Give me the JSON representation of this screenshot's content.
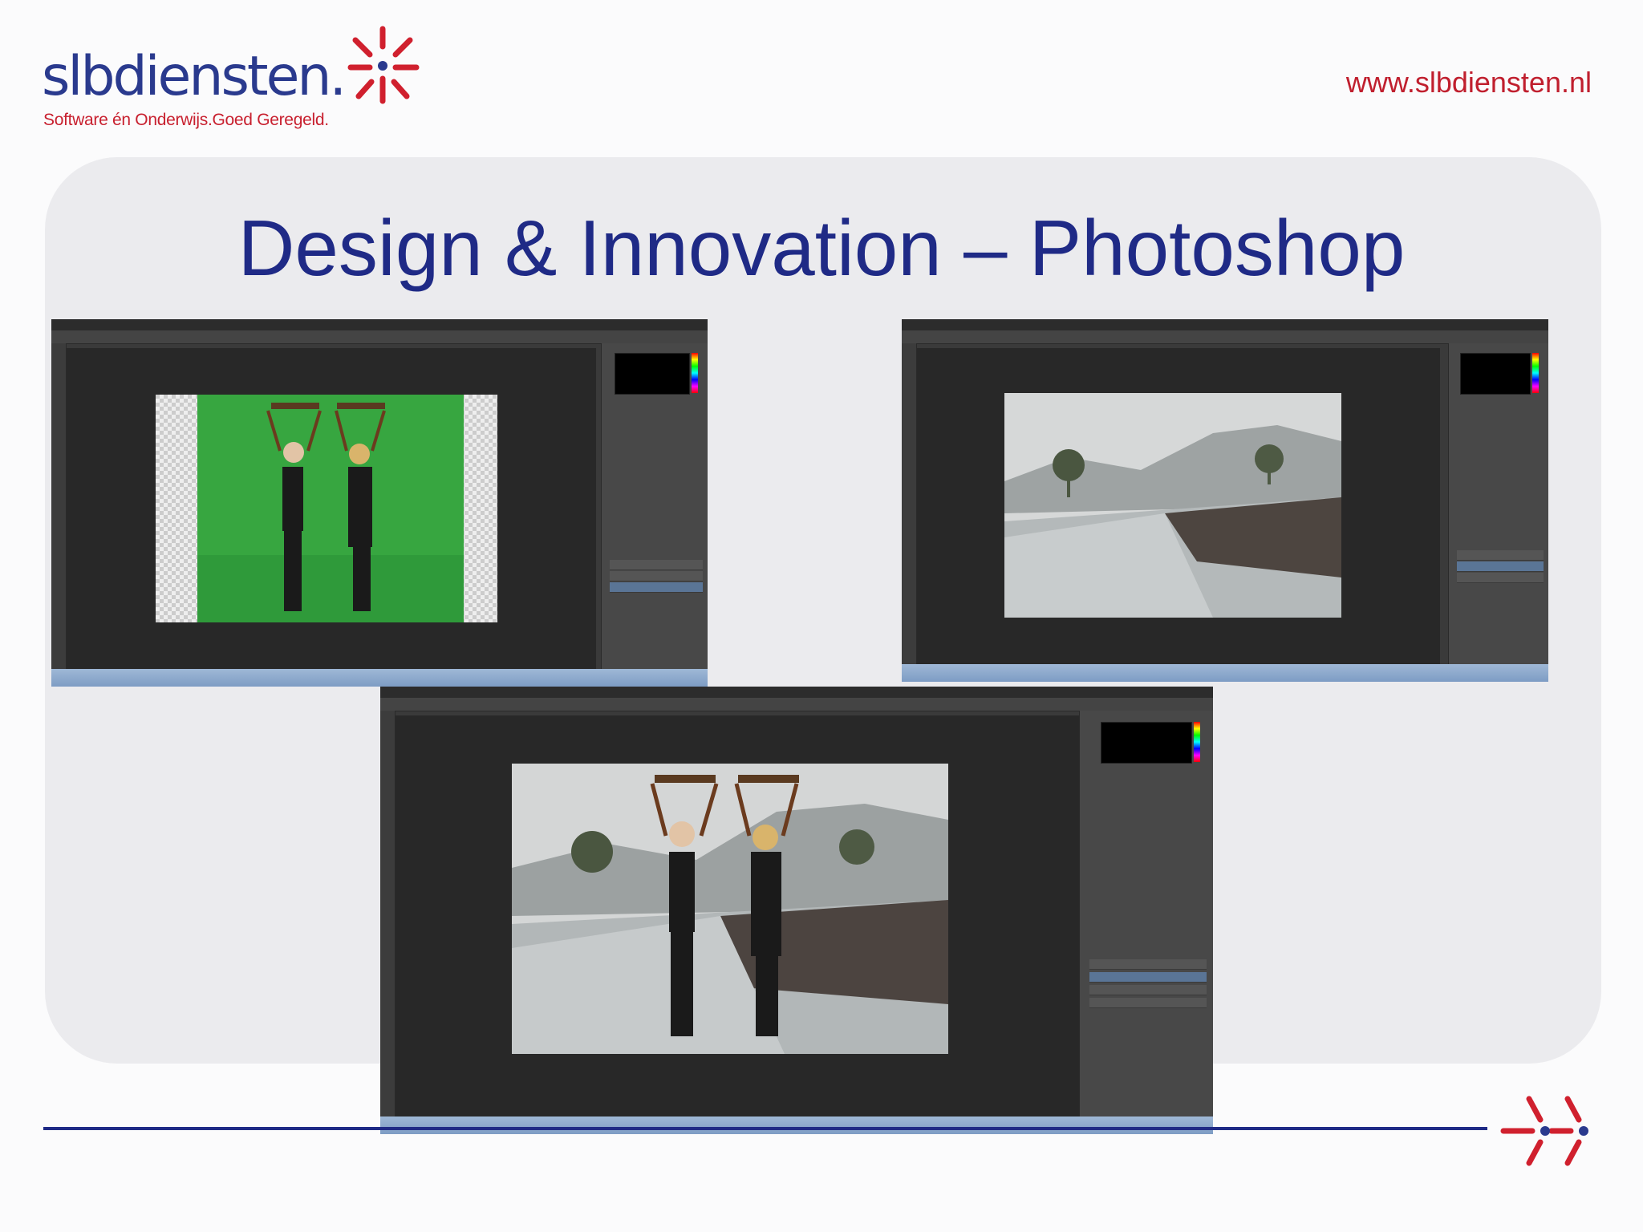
{
  "header": {
    "logo_text": "slbdiensten.",
    "logo_tagline": "Software én Onderwijs.Goed Geregeld.",
    "url": "www.slbdiensten.nl"
  },
  "slide": {
    "title": "Design & Innovation – Photoshop"
  },
  "screenshots": [
    {
      "name": "green-screen-photo",
      "content": "two girls with stools on heads in front of green screen"
    },
    {
      "name": "landscape-photo",
      "content": "rainy landscape with road and trees"
    },
    {
      "name": "composite-photo",
      "content": "girls composited into rainy landscape"
    }
  ],
  "colors": {
    "brand_blue": "#1f2a86",
    "brand_red": "#c8202f",
    "panel_bg": "#ebebee",
    "photoshop_dark": "#3a3a3a"
  }
}
